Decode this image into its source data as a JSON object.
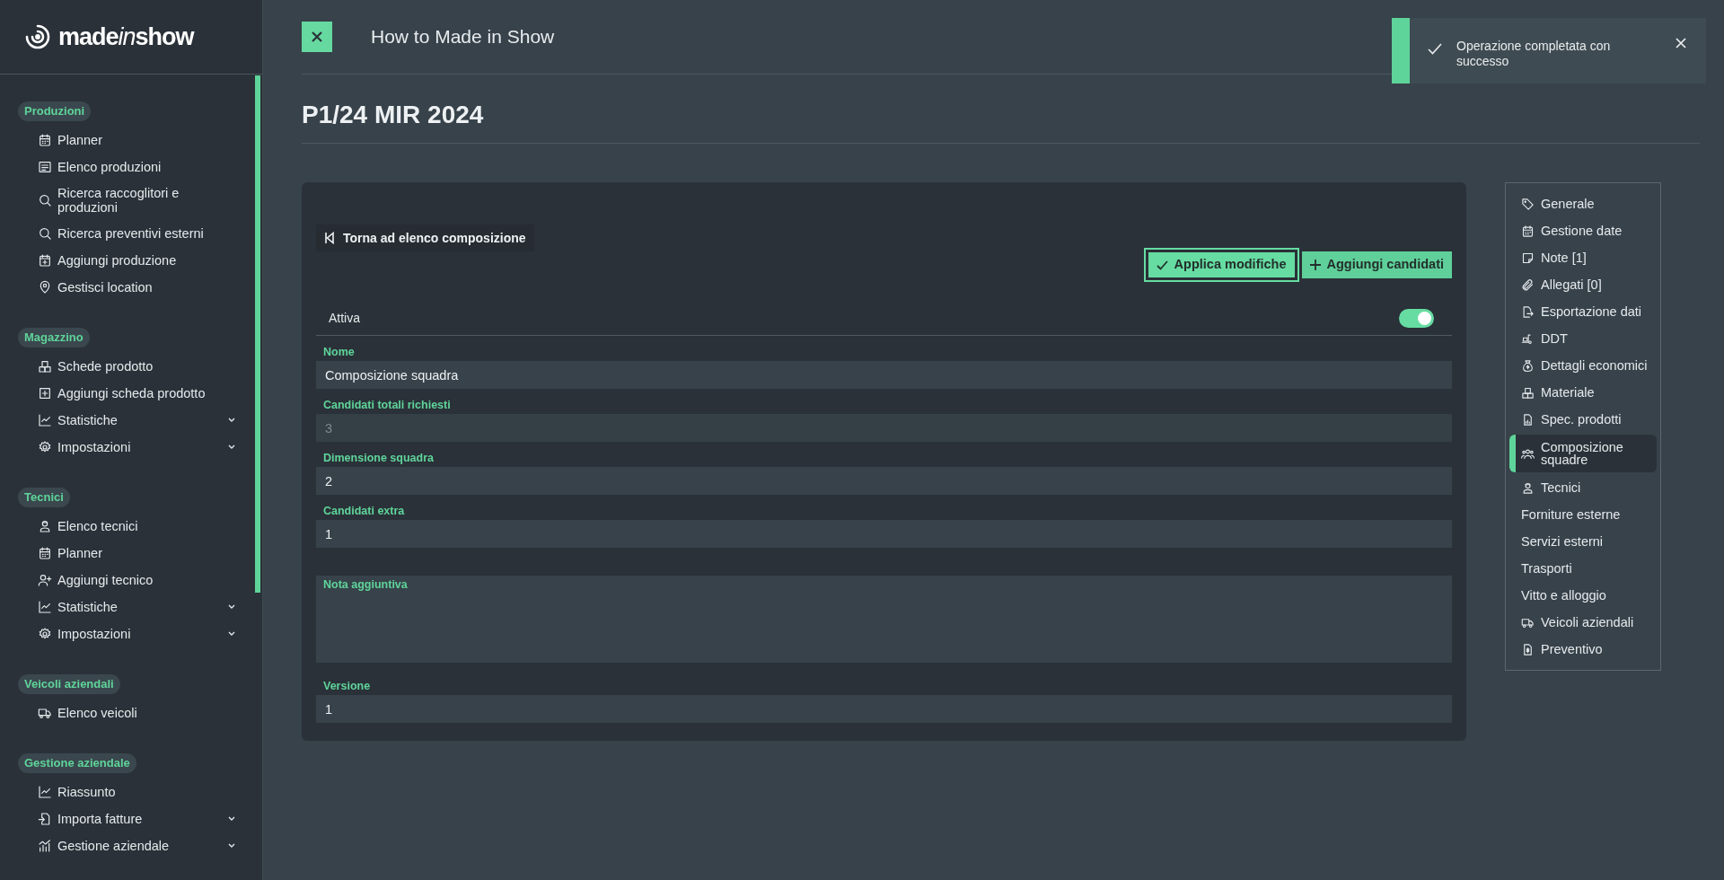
{
  "logo": {
    "prefix": "made",
    "accent": "in",
    "suffix": "show"
  },
  "sidebar": {
    "sections": [
      {
        "title": "Produzioni",
        "items": [
          {
            "label": "Planner",
            "kind": "link"
          },
          {
            "label": "Elenco produzioni",
            "kind": "link"
          },
          {
            "label": "Ricerca raccoglitori e produzioni",
            "kind": "link"
          },
          {
            "label": "Ricerca preventivi esterni",
            "kind": "link"
          },
          {
            "label": "Aggiungi produzione",
            "kind": "link"
          },
          {
            "label": "Gestisci location",
            "kind": "link"
          }
        ]
      },
      {
        "title": "Magazzino",
        "items": [
          {
            "label": "Schede prodotto",
            "kind": "link"
          },
          {
            "label": "Aggiungi scheda prodotto",
            "kind": "link"
          },
          {
            "label": "Statistiche",
            "kind": "group"
          },
          {
            "label": "Impostazioni",
            "kind": "group"
          }
        ]
      },
      {
        "title": "Tecnici",
        "items": [
          {
            "label": "Elenco tecnici",
            "kind": "link"
          },
          {
            "label": "Planner",
            "kind": "link"
          },
          {
            "label": "Aggiungi tecnico",
            "kind": "link"
          },
          {
            "label": "Statistiche",
            "kind": "group"
          },
          {
            "label": "Impostazioni",
            "kind": "group"
          }
        ]
      },
      {
        "title": "Veicoli aziendali",
        "items": [
          {
            "label": "Elenco veicoli",
            "kind": "link"
          }
        ]
      },
      {
        "title": "Gestione aziendale",
        "items": [
          {
            "label": "Riassunto",
            "kind": "link"
          },
          {
            "label": "Importa fatture",
            "kind": "group"
          },
          {
            "label": "Gestione aziendale",
            "kind": "group"
          }
        ]
      }
    ]
  },
  "header": {
    "title": "How to Made in Show"
  },
  "toast": {
    "message": "Operazione completata con successo"
  },
  "page_title": "P1/24 MIR 2024",
  "card": {
    "back_button": "Torna ad elenco composizione",
    "actions": [
      {
        "label": "Applica modifiche",
        "kind": "apply"
      },
      {
        "label": "Aggiungi candidati",
        "kind": "add"
      }
    ],
    "active": {
      "label": "Attiva",
      "on": true
    },
    "fields": [
      {
        "label": "Nome",
        "value": "Composizione squadra",
        "kind": "input",
        "disabled": false
      },
      {
        "label": "Candidati totali richiesti",
        "value": "3",
        "kind": "input",
        "disabled": true
      },
      {
        "label": "Dimensione squadra",
        "value": "2",
        "kind": "input",
        "disabled": false
      },
      {
        "label": "Candidati extra",
        "value": "1",
        "kind": "input",
        "disabled": false
      },
      {
        "label": "Nota aggiuntiva",
        "kind": "textarea",
        "disabled": false
      },
      {
        "label": "Versione",
        "value": "1",
        "kind": "input",
        "disabled": false
      }
    ]
  },
  "side_nav": {
    "items": [
      {
        "label": "Generale",
        "selected": false
      },
      {
        "label": "Gestione date",
        "selected": false
      },
      {
        "label": "Note [1]",
        "selected": false
      },
      {
        "label": "Allegati [0]",
        "selected": false
      },
      {
        "label": "Esportazione dati",
        "selected": false
      },
      {
        "label": "DDT",
        "selected": false
      },
      {
        "label": "Dettagli economici",
        "selected": false
      },
      {
        "label": "Materiale",
        "selected": false
      },
      {
        "label": "Spec. prodotti",
        "selected": false
      },
      {
        "label": "Composizione squadre",
        "selected": true
      },
      {
        "label": "Tecnici",
        "selected": false
      },
      {
        "label": "Forniture esterne",
        "selected": false
      },
      {
        "label": "Servizi esterni",
        "selected": false
      },
      {
        "label": "Trasporti",
        "selected": false
      },
      {
        "label": "Vitto e alloggio",
        "selected": false
      },
      {
        "label": "Veicoli aziendali",
        "selected": false
      },
      {
        "label": "Preventivo",
        "selected": false
      }
    ]
  }
}
